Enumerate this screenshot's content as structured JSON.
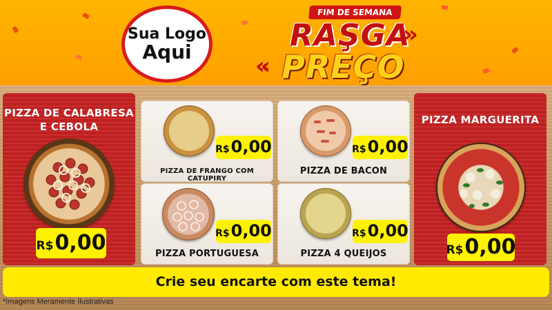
{
  "logo": {
    "line1": "Sua Logo",
    "line2": "Aqui"
  },
  "banner": {
    "tag": "FIM DE SEMANA",
    "line1": "RAŞGA",
    "line2": "PREÇO",
    "accent_red": "#c40f0f",
    "accent_yellow": "#ffd21a"
  },
  "featured_left": {
    "title_line1": "PIZZA DE CALABRESA",
    "title_line2": "E CEBOLA",
    "currency": "R$",
    "price": "0,00"
  },
  "featured_right": {
    "title": "PIZZA MARGUERITA",
    "currency": "R$",
    "price": "0,00"
  },
  "cards": [
    {
      "label": "PIZZA DE FRANGO COM CATUPIRY",
      "currency": "R$",
      "price": "0,00"
    },
    {
      "label": "PIZZA DE BACON",
      "currency": "R$",
      "price": "0,00"
    },
    {
      "label": "PIZZA PORTUGUESA",
      "currency": "R$",
      "price": "0,00"
    },
    {
      "label": "PIZZA 4 QUEIJOS",
      "currency": "R$",
      "price": "0,00"
    }
  ],
  "cta": "Crie seu encarte com este tema!",
  "footnote": "*Imagens Meramente Ilustrativas",
  "colors": {
    "header": "#ffa000",
    "panel_red": "#c72323",
    "price_yellow": "#fff200"
  }
}
